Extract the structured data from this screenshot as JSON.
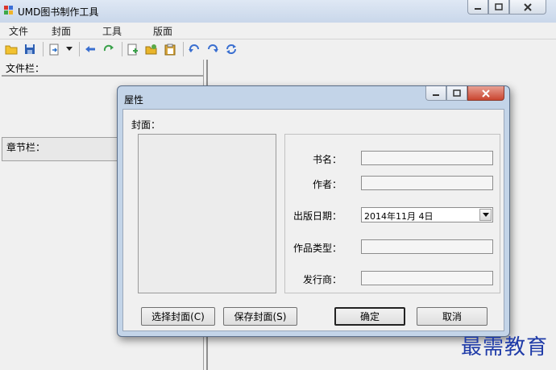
{
  "window": {
    "title": "UMD图书制作工具"
  },
  "menu": {
    "items": [
      "文件",
      "封面",
      "工具",
      "版面"
    ]
  },
  "toolbar": {
    "icons": [
      "open-folder-icon",
      "save-icon",
      "export-icon",
      "dropdown-arrow-icon",
      "back-arrow-icon",
      "forward-arrow-icon",
      "add-document-icon",
      "folder-icon",
      "clipboard-icon",
      "undo-icon",
      "redo-icon",
      "refresh-icon"
    ]
  },
  "panels": {
    "file_label": "文件栏：",
    "chapter_label": "章节栏："
  },
  "dialog": {
    "title": "屋性",
    "cover_label": "封面：",
    "fields": {
      "book_name_label": "书名：",
      "book_name_value": "",
      "author_label": "作者：",
      "author_value": "",
      "date_label": "出版日期：",
      "date_value": "2014年11月  4日",
      "genre_label": "作品类型：",
      "genre_value": "",
      "publisher_label": "发行商：",
      "publisher_value": ""
    },
    "buttons": {
      "select_cover": "选择封面(C)",
      "save_cover": "保存封面(S)",
      "ok": "确定",
      "cancel": "取消"
    }
  },
  "watermark": "最需教育",
  "colors": {
    "titlebar": "#c9d7ea",
    "dialog_frame": "#c3d4e8",
    "close_red": "#c9452f",
    "watermark": "#1f3ba8"
  }
}
